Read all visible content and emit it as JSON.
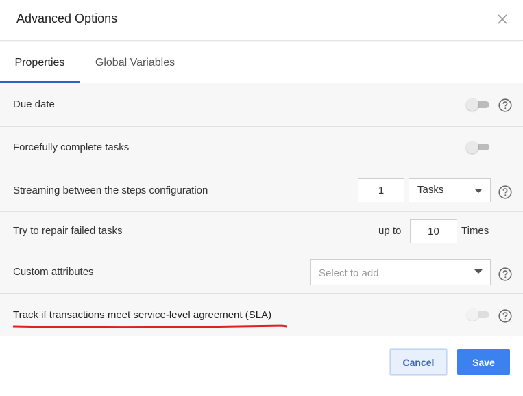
{
  "dialog": {
    "title": "Advanced Options"
  },
  "tabs": [
    {
      "label": "Properties",
      "active": true
    },
    {
      "label": "Global Variables",
      "active": false
    }
  ],
  "rows": {
    "due_date": {
      "label": "Due date",
      "toggle_on": false
    },
    "force_complete": {
      "label": "Forcefully complete tasks",
      "toggle_on": false
    },
    "streaming": {
      "label": "Streaming between the steps configuration",
      "count": "1",
      "unit_selected": "Tasks"
    },
    "repair": {
      "label": "Try to repair failed tasks",
      "prefix": "up to",
      "count": "10",
      "suffix": "Times"
    },
    "custom_attrs": {
      "label": "Custom attributes",
      "placeholder": "Select to add"
    },
    "sla": {
      "label": "Track if transactions meet service-level agreement (SLA)",
      "toggle_on": false,
      "toggle_disabled": true
    }
  },
  "footer": {
    "cancel_label": "Cancel",
    "save_label": "Save"
  },
  "colors": {
    "accent": "#2f62c6",
    "save_button": "#3b82ee",
    "annotation_underline": "#e02020"
  },
  "icons": [
    "close-icon",
    "help-icon",
    "chevron-down-icon"
  ]
}
